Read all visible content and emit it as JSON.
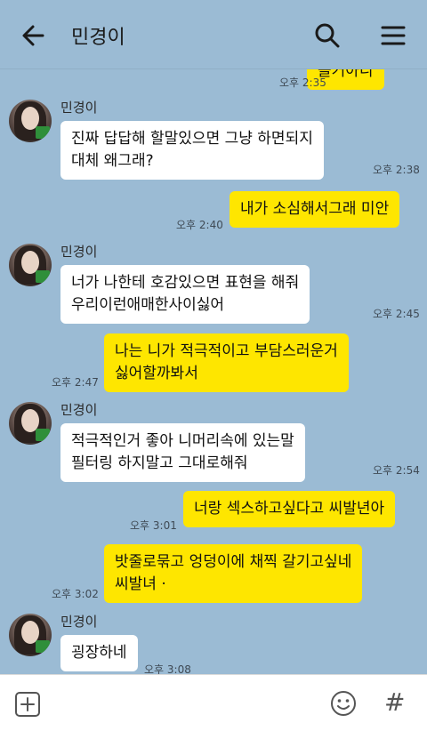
{
  "header": {
    "title": "민경이",
    "icons": {
      "back": "arrow-left-icon",
      "search": "search-icon",
      "menu": "hamburger-menu-icon"
    }
  },
  "chat": {
    "contact_name": "민경이",
    "messages": [
      {
        "id": 0,
        "sender": "me",
        "lines": [
          "을거아니"
        ],
        "time": "오후 2:35"
      },
      {
        "id": 1,
        "sender": "them",
        "lines": [
          "진짜 답답해 할말있으면 그냥 하면되지",
          "대체 왜그래?"
        ],
        "time": "오후 2:38"
      },
      {
        "id": 2,
        "sender": "me",
        "lines": [
          "내가 소심해서그래 미안"
        ],
        "time": "오후 2:40"
      },
      {
        "id": 3,
        "sender": "them",
        "lines": [
          "너가 나한테 호감있으면 표현을 해줘",
          "우리이런애매한사이싫어"
        ],
        "time": "오후 2:45"
      },
      {
        "id": 4,
        "sender": "me",
        "lines": [
          "나는 니가 적극적이고 부담스러운거",
          "싫어할까봐서"
        ],
        "time": "오후 2:47"
      },
      {
        "id": 5,
        "sender": "them",
        "lines": [
          "적극적인거 좋아 니머리속에 있는말",
          "필터링 하지말고 그대로해줘"
        ],
        "time": "오후 2:54"
      },
      {
        "id": 6,
        "sender": "me",
        "lines": [
          "너랑 섹스하고싶다고 씨발년아"
        ],
        "time": "오후 3:01"
      },
      {
        "id": 7,
        "sender": "me",
        "lines": [
          "밧줄로묶고 엉덩이에 채찍 갈기고싶네",
          "씨발녀 ·"
        ],
        "time": "오후 3:02"
      },
      {
        "id": 8,
        "sender": "them",
        "lines": [
          "굉장하네"
        ],
        "time": "오후 3:08"
      }
    ]
  },
  "colors": {
    "background": "#9bbbd4",
    "my_bubble": "#fee600",
    "their_bubble": "#ffffff",
    "input_bar": "#ffffff"
  },
  "footer": {
    "icons": {
      "attach": "plus-square-icon",
      "emoji": "smiley-icon",
      "hash": "hash-icon"
    },
    "hash_symbol": "#"
  }
}
